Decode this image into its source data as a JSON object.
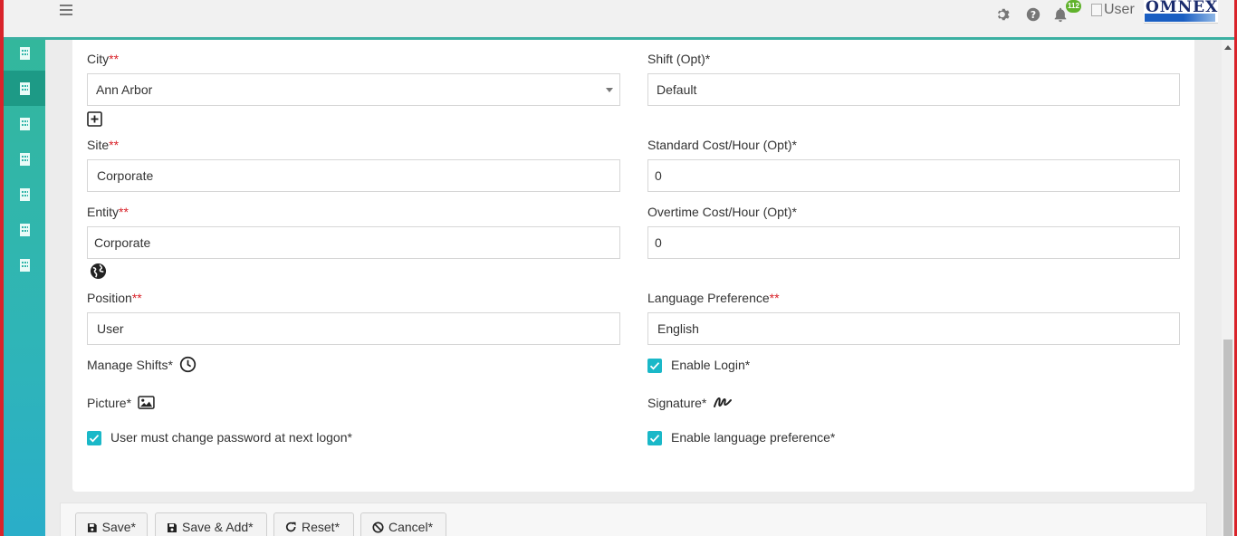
{
  "topbar": {
    "notification_count": "112",
    "user_alt": "User",
    "logo_text": "OMNEX",
    "icons": [
      "menu-icon",
      "gear-icon",
      "help-icon",
      "bell-icon"
    ]
  },
  "sidebar": {
    "items": [
      {
        "icon": "building-icon",
        "active": false
      },
      {
        "icon": "building-icon",
        "active": true
      },
      {
        "icon": "building-icon",
        "active": false
      },
      {
        "icon": "building-icon",
        "active": false
      },
      {
        "icon": "building-icon",
        "active": false
      },
      {
        "icon": "building-icon",
        "active": false
      },
      {
        "icon": "building-icon",
        "active": false
      }
    ]
  },
  "form": {
    "city": {
      "label": "City",
      "req": "**",
      "value": "Ann Arbor"
    },
    "shift": {
      "label": "Shift (Opt)*",
      "value": "Default"
    },
    "site": {
      "label": "Site",
      "req": "**",
      "value": "Corporate"
    },
    "std_cost": {
      "label": "Standard Cost/Hour (Opt)*",
      "value": "0"
    },
    "entity": {
      "label": "Entity",
      "req": "**",
      "value": "Corporate"
    },
    "ot_cost": {
      "label": "Overtime Cost/Hour (Opt)*",
      "value": "0"
    },
    "position": {
      "label": "Position",
      "req": "**",
      "value": "User"
    },
    "language": {
      "label": "Language Preference",
      "req": "**",
      "value": "English"
    },
    "manage_shifts": {
      "label": "Manage Shifts*"
    },
    "enable_login": {
      "label": "Enable Login*",
      "checked": true
    },
    "picture": {
      "label": "Picture*"
    },
    "signature": {
      "label": "Signature*"
    },
    "must_change_pw": {
      "label": "User must change password at next logon*",
      "checked": true
    },
    "enable_lang_pref": {
      "label": "Enable language preference*",
      "checked": true
    }
  },
  "footer": {
    "save": "Save*",
    "save_add": "Save & Add*",
    "reset": "Reset*",
    "cancel": "Cancel*"
  },
  "colors": {
    "accent": "#1ab8c8",
    "frame": "#d9232a",
    "sidebar_active": "#1d9a86",
    "required": "#d9232a"
  }
}
